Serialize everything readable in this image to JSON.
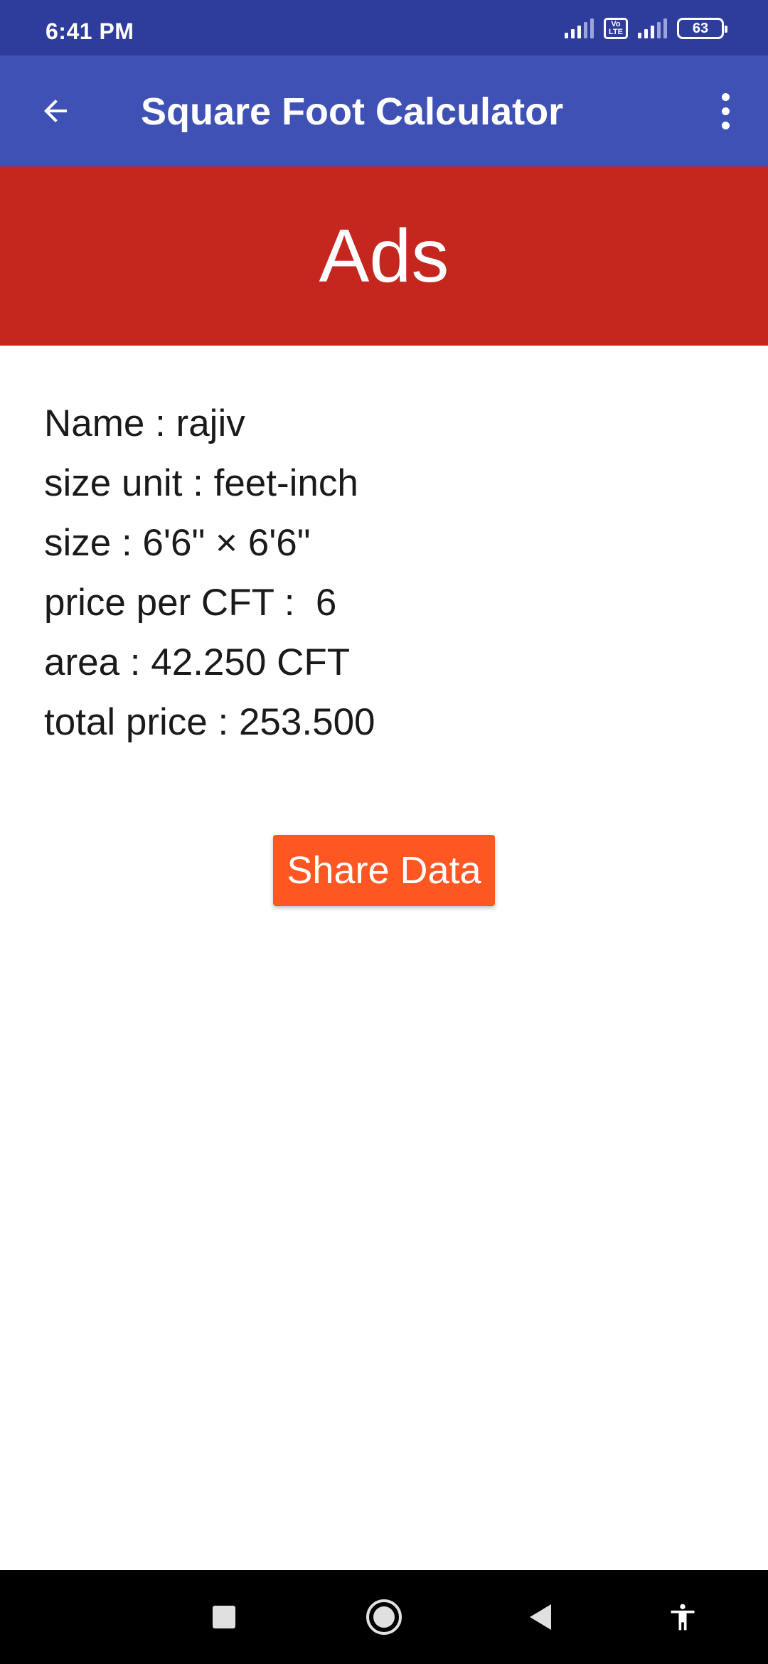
{
  "status_bar": {
    "time": "6:41 PM",
    "volte_top": "Vo",
    "volte_bottom": "LTE",
    "battery": "63"
  },
  "app_bar": {
    "title": "Square Foot Calculator"
  },
  "ad_banner": {
    "text": "Ads"
  },
  "details": {
    "name": "Name : rajiv",
    "size_unit": "size unit : feet-inch",
    "size": "size : 6'6\" × 6'6\"",
    "price_per_cft": "price per CFT :  6",
    "area": "area : 42.250 CFT",
    "total_price": "total price : 253.500"
  },
  "actions": {
    "share_label": "Share Data"
  },
  "colors": {
    "status_bar": "#2e3d9c",
    "app_bar": "#3f51b5",
    "ad_banner": "#c5261d",
    "share_button": "#ff5722"
  }
}
